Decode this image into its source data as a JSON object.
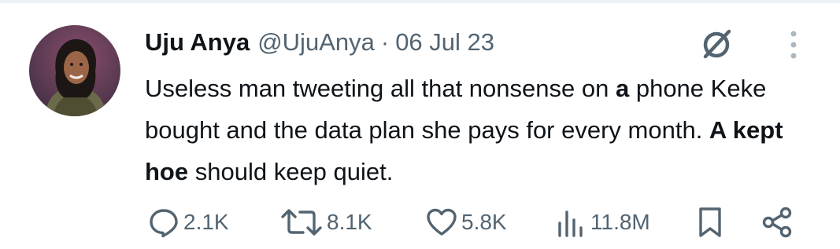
{
  "tweet": {
    "author": {
      "display_name": "Uju Anya",
      "handle": "@UjuAnya",
      "avatar_icon": "profile-photo"
    },
    "separator": "·",
    "date": "06 Jul 23",
    "text_segments": [
      {
        "text": "Useless man tweeting all that nonsense on ",
        "bold": false
      },
      {
        "text": "a",
        "bold": true
      },
      {
        "text": " phone Keke bought and the data plan she pays for every month. ",
        "bold": false
      },
      {
        "text": "A kept hoe",
        "bold": true
      },
      {
        "text": " should keep quiet.",
        "bold": false
      }
    ],
    "stats": {
      "replies": "2.1K",
      "retweets": "8.1K",
      "likes": "5.8K",
      "views": "11.8M"
    },
    "icons": {
      "grok": "grok-slash-icon",
      "more": "more-vertical-icon",
      "reply": "reply-icon",
      "retweet": "retweet-icon",
      "like": "heart-icon",
      "views": "views-chart-icon",
      "bookmark": "bookmark-icon",
      "share": "share-icon"
    },
    "colors": {
      "text_primary": "#0f1419",
      "text_secondary": "#536471",
      "icon_light": "#aab8c2"
    }
  }
}
